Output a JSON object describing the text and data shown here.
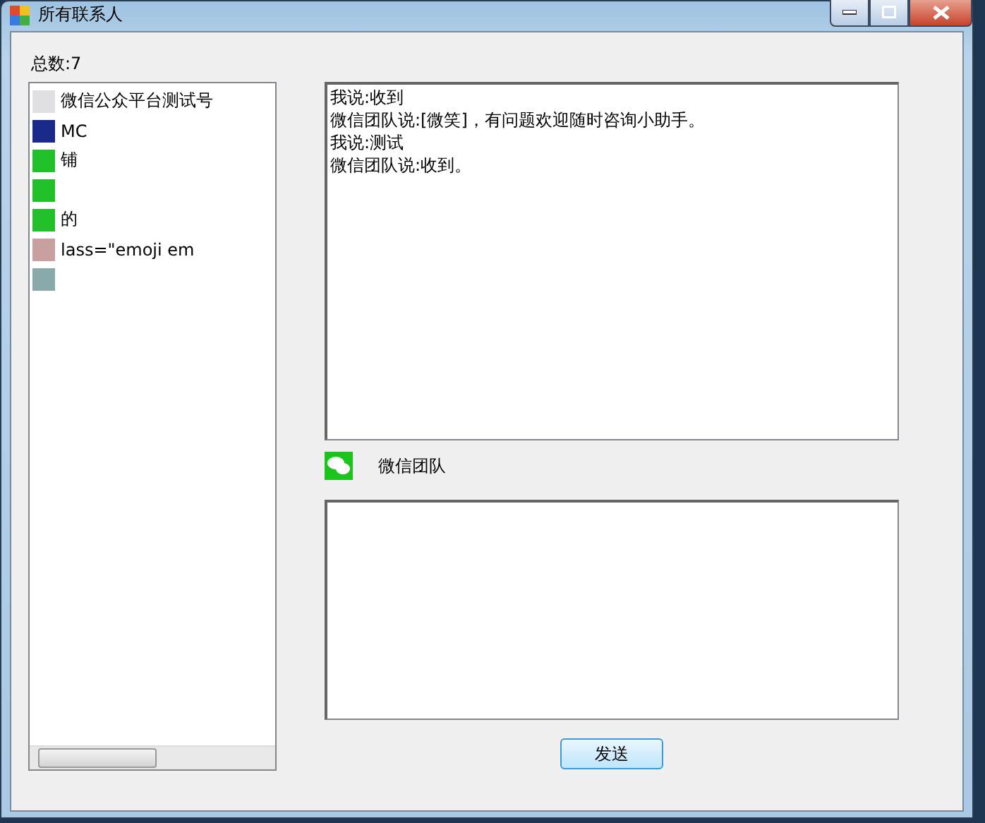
{
  "window": {
    "title": "所有联系人"
  },
  "total_label": "总数:7",
  "contacts": [
    {
      "name": "微信公众平台测试号",
      "kind": "plain"
    },
    {
      "name": "MC",
      "kind": "dark"
    },
    {
      "name": "铺",
      "kind": "green"
    },
    {
      "kind": "green"
    },
    {
      "name": "的",
      "kind": "green"
    },
    {
      "name": "lass=\"emoji em",
      "kind": "photo"
    },
    {
      "kind": "avatar"
    }
  ],
  "chat_log": [
    "我说:收到",
    "微信团队说:[微笑]，有问题欢迎随时咨询小助手。",
    "我说:测试",
    "微信团队说:收到。"
  ],
  "current_contact": {
    "name": "微信团队"
  },
  "send_button": "发送"
}
